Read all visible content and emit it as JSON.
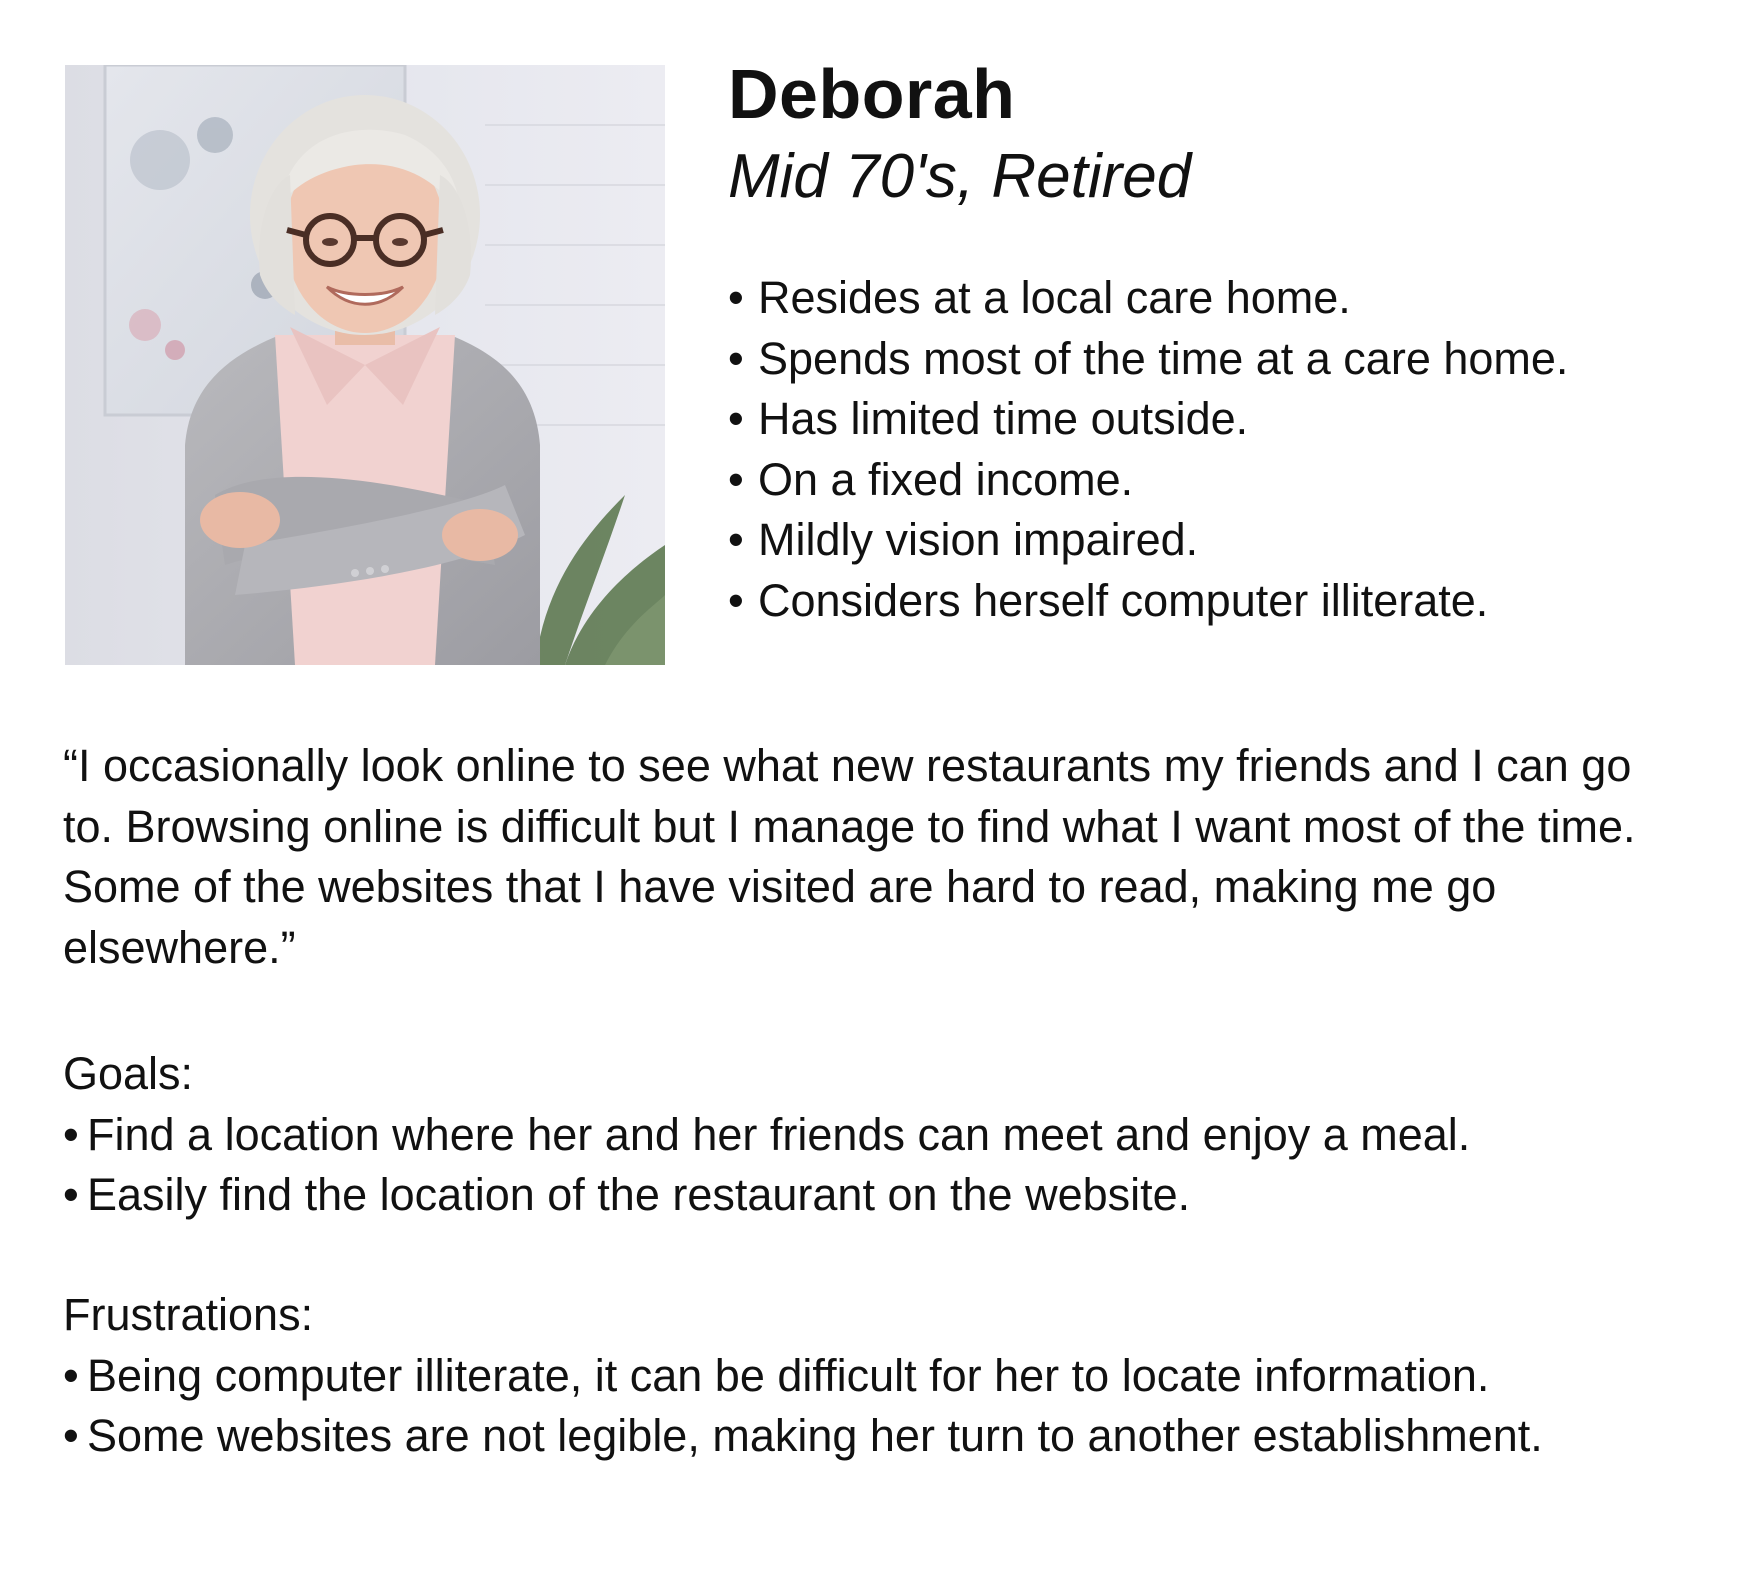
{
  "persona": {
    "name": "Deborah",
    "subtitle": "Mid 70's, Retired",
    "photo_icon": "portrait-photo"
  },
  "traits": [
    "Resides at a local care home.",
    "Spends most of the time at a care home.",
    "Has limited time outside.",
    "On a fixed income.",
    "Mildly vision impaired.",
    "Considers herself computer illiterate."
  ],
  "quote": "“I occasionally look online to see what new restaurants my friends and I can go to. Browsing online is difficult but I manage to find what I want most of the time. Some of the websites that I have visited are hard to read, making me go elsewhere.”",
  "goals": {
    "title": "Goals:",
    "items": [
      "Find a location where her and her friends can meet and enjoy a meal.",
      "Easily find the location of the restaurant on the website."
    ]
  },
  "frustrations": {
    "title": "Frustrations:",
    "items": [
      "Being computer illiterate, it can be difficult for her to locate information.",
      "Some websites are not legible, making her turn to another establishment."
    ]
  },
  "bullet_char": "•",
  "colors": {
    "text": "#111111",
    "background": "#ffffff"
  }
}
